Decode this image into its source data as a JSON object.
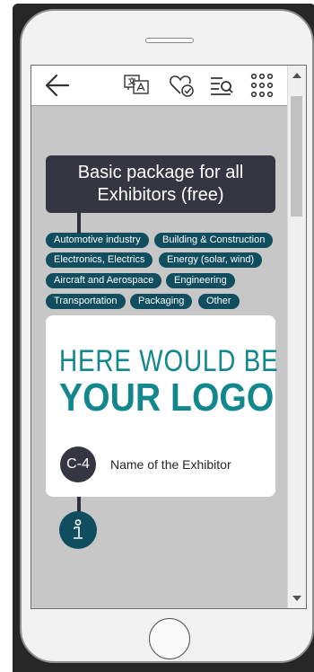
{
  "header": {
    "package_title": "Basic package for all Exhibitors (free)"
  },
  "categories": [
    "Automotive industry",
    "Building & Construction",
    "Electronics, Electrics",
    "Energy (solar, wind)",
    "Aircraft and Aerospace",
    "Engineering",
    "Transportation",
    "Packaging",
    "Other"
  ],
  "card": {
    "logo_line1": "HERE WOULD BE",
    "logo_line2": "YOUR LOGO",
    "booth": "C-4",
    "exhibitor_name": "Name of the Exhibitor"
  },
  "icons": {
    "back": "arrow-left-icon",
    "translate": "translate-icon",
    "favorite": "heart-check-icon",
    "search": "list-search-icon",
    "menu": "grid-menu-icon",
    "info": "info-icon"
  },
  "colors": {
    "teal": "#0f4d5f",
    "logo_teal": "#12878d",
    "dark": "#363642",
    "screen_bg": "#c7c7c7"
  }
}
